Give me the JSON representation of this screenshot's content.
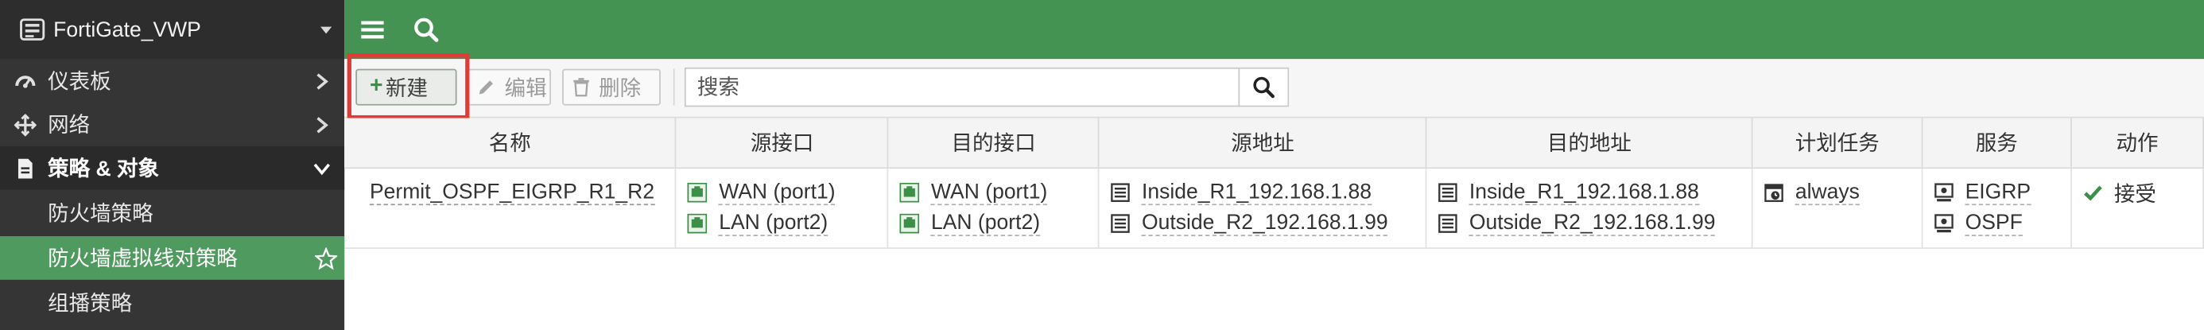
{
  "sidebar": {
    "device_name": "FortiGate_VWP",
    "items": [
      {
        "label": "仪表板",
        "icon": "dashboard-icon"
      },
      {
        "label": "网络",
        "icon": "network-icon"
      },
      {
        "label": "策略 & 对象",
        "icon": "policy-icon"
      }
    ],
    "sub_items": [
      {
        "label": "防火墙策略"
      },
      {
        "label": "防火墙虚拟线对策略"
      },
      {
        "label": "组播策略"
      }
    ]
  },
  "topbar": {
    "menu_icon": "hamburger-icon",
    "search_icon": "search-icon"
  },
  "toolbar": {
    "new_label": "新建",
    "edit_label": "编辑",
    "delete_label": "删除",
    "search_placeholder": "搜索"
  },
  "table": {
    "columns": [
      "名称",
      "源接口",
      "目的接口",
      "源地址",
      "目的地址",
      "计划任务",
      "服务",
      "动作"
    ],
    "rows": [
      {
        "name": "Permit_OSPF_EIGRP_R1_R2",
        "src_intf": [
          "WAN (port1)",
          "LAN (port2)"
        ],
        "dst_intf": [
          "WAN (port1)",
          "LAN (port2)"
        ],
        "src_addr": [
          "Inside_R1_192.168.1.88",
          "Outside_R2_192.168.1.99"
        ],
        "dst_addr": [
          "Inside_R1_192.168.1.88",
          "Outside_R2_192.168.1.99"
        ],
        "schedule": "always",
        "services": [
          "EIGRP",
          "OSPF"
        ],
        "action": "接受"
      }
    ]
  },
  "colors": {
    "brand_green": "#459352",
    "active_green": "#4f9a5e",
    "sidebar_dark": "#353535",
    "highlight_red": "#e53935"
  }
}
